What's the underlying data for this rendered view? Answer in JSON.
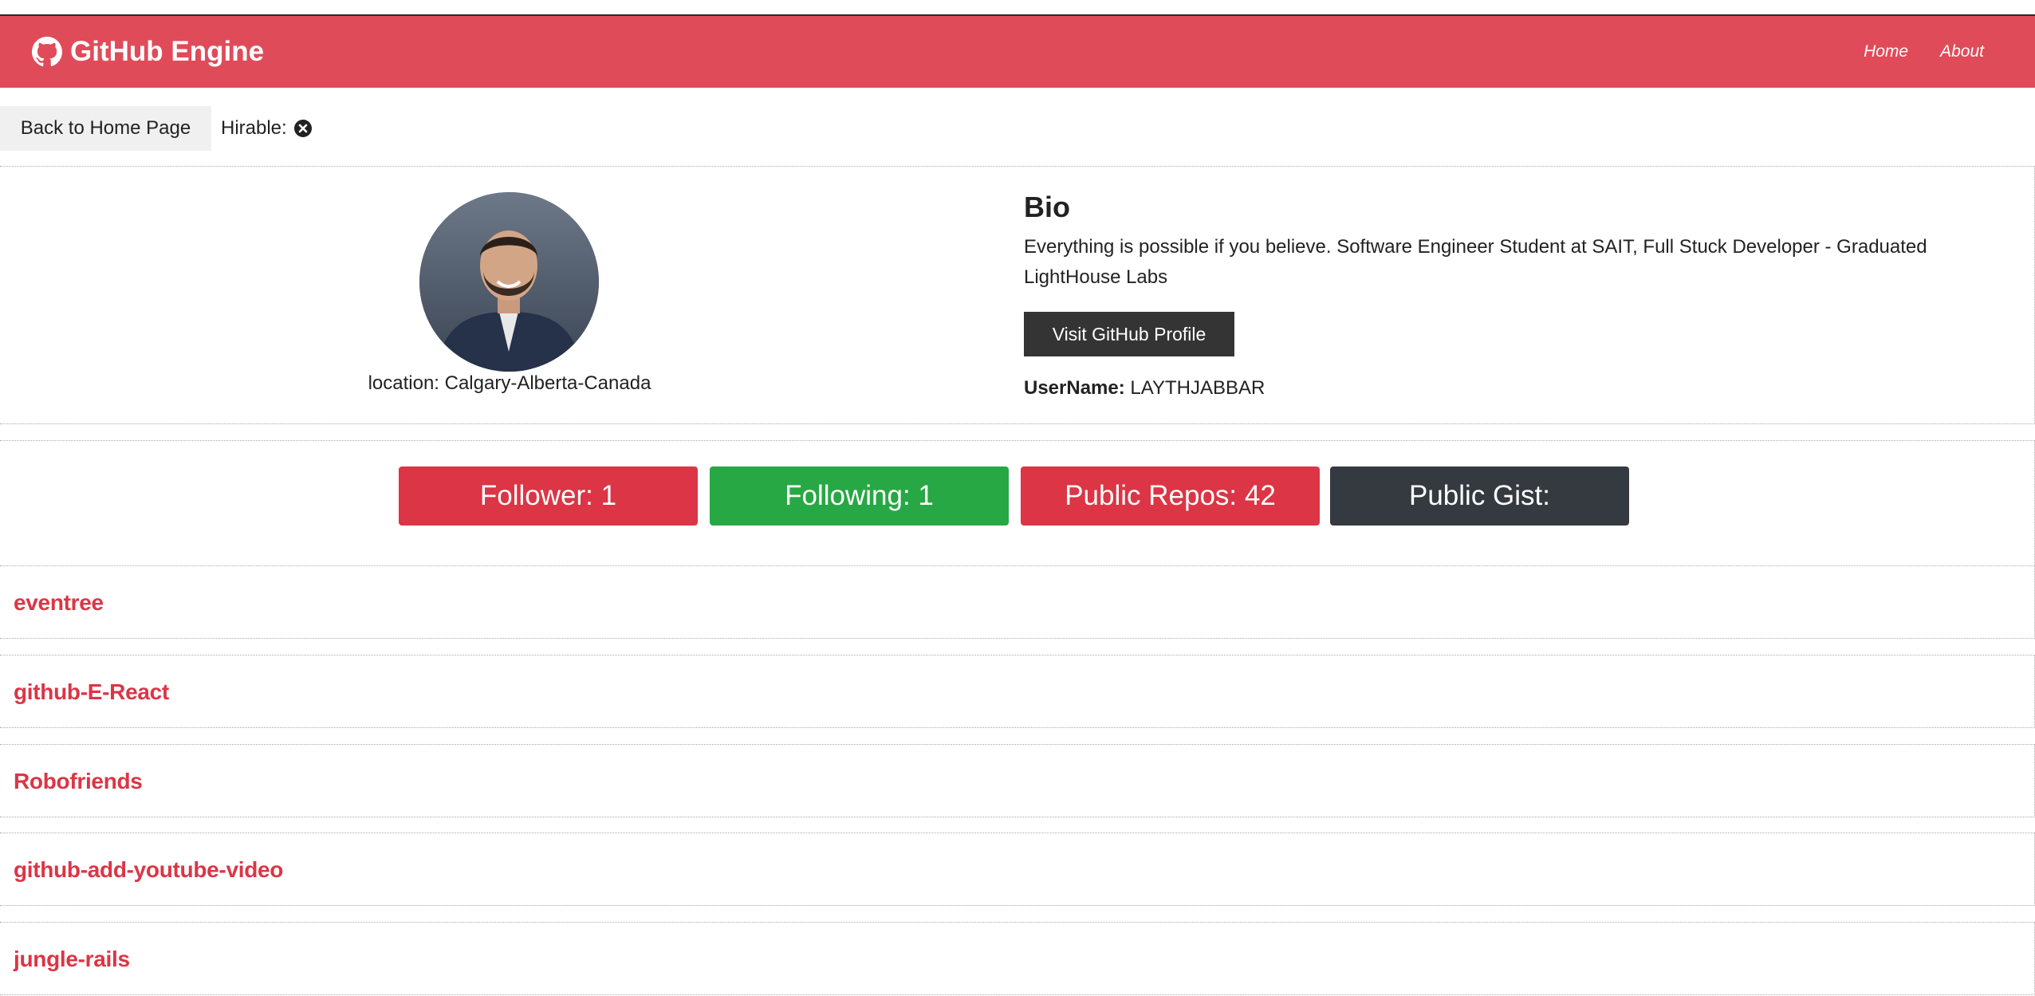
{
  "navbar": {
    "brand": "GitHub Engine",
    "links": [
      "Home",
      "About"
    ]
  },
  "actions": {
    "back_label": "Back to Home Page",
    "hirable_label": "Hirable:",
    "hirable_icon": "times-circle-icon"
  },
  "profile": {
    "location": "location: Calgary-Alberta-Canada",
    "bio_title": "Bio",
    "bio_text": "Everything is possible if you believe. Software Engineer Student at SAIT, Full Stuck Developer - Graduated LightHouse Labs",
    "visit_label": "Visit GitHub Profile",
    "username_label": "UserName:",
    "username_value": "LAYTHJABBAR"
  },
  "stats": {
    "followers": "Follower: 1",
    "following": "Following: 1",
    "repos": "Public Repos: 42",
    "gists": "Public Gist:"
  },
  "repos": [
    "eventree",
    "github-E-React",
    "Robofriends",
    "github-add-youtube-video",
    "jungle-rails"
  ],
  "colors": {
    "navbar": "#e04b5a",
    "danger": "#dc3545",
    "success": "#28a745",
    "dark": "#343a40"
  }
}
